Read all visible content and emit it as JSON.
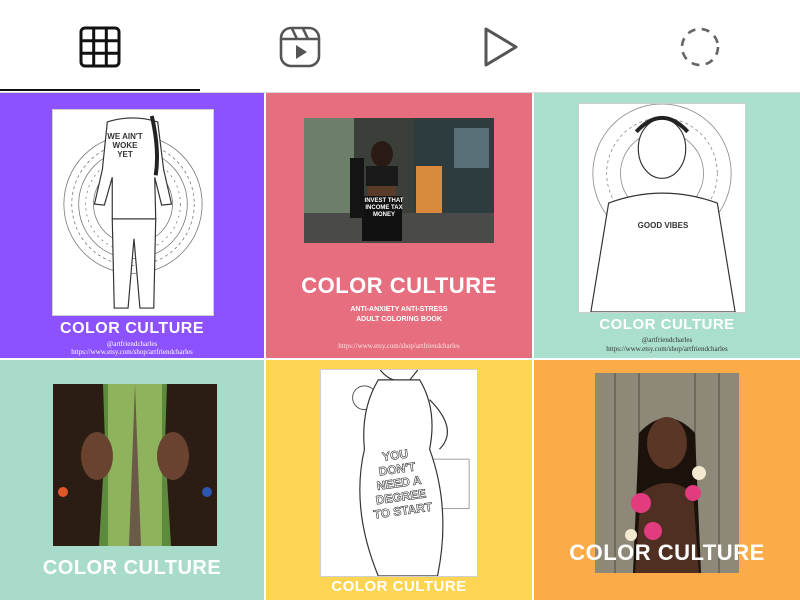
{
  "tabs": [
    {
      "name": "grid",
      "icon": "grid-icon",
      "active": true
    },
    {
      "name": "reels",
      "icon": "reels-icon",
      "active": false
    },
    {
      "name": "videos",
      "icon": "play-icon",
      "active": false
    },
    {
      "name": "loading",
      "icon": "loading-spinner-icon",
      "active": false
    }
  ],
  "colors": {
    "purple": "#8c52ff",
    "pink": "#e66e7e",
    "mint": "#a9dfcc",
    "mint2": "#a8dbc9",
    "yellow": "#fdd553",
    "orange": "#fbab48"
  },
  "posts": [
    {
      "brand": "COLOR CULTURE",
      "shirt_text": "WE AIN'T WOKE YET",
      "handle": "@artfriendcharles",
      "url": "https://www.etsy.com/shop/artfriendcharles"
    },
    {
      "brand": "COLOR CULTURE",
      "subtitle_line1": "ANTI-ANXIETY ANTI-STRESS",
      "subtitle_line2": "ADULT COLORING BOOK",
      "shirt_text": "INVEST THAT INCOME TAX MONEY",
      "url": "https://www.etsy.com/shop/artfriendcharles"
    },
    {
      "brand": "COLOR CULTURE",
      "shirt_text": "GOOD VIBES",
      "handle": "@artfriendcharles",
      "url": "https://www.etsy.com/shop/artfriendcharles"
    },
    {
      "brand": "COLOR CULTURE"
    },
    {
      "brand": "COLOR CULTURE",
      "shirt_text": "YOU DON'T NEED A DEGREE TO START"
    },
    {
      "brand": "COLOR CULTURE"
    }
  ]
}
